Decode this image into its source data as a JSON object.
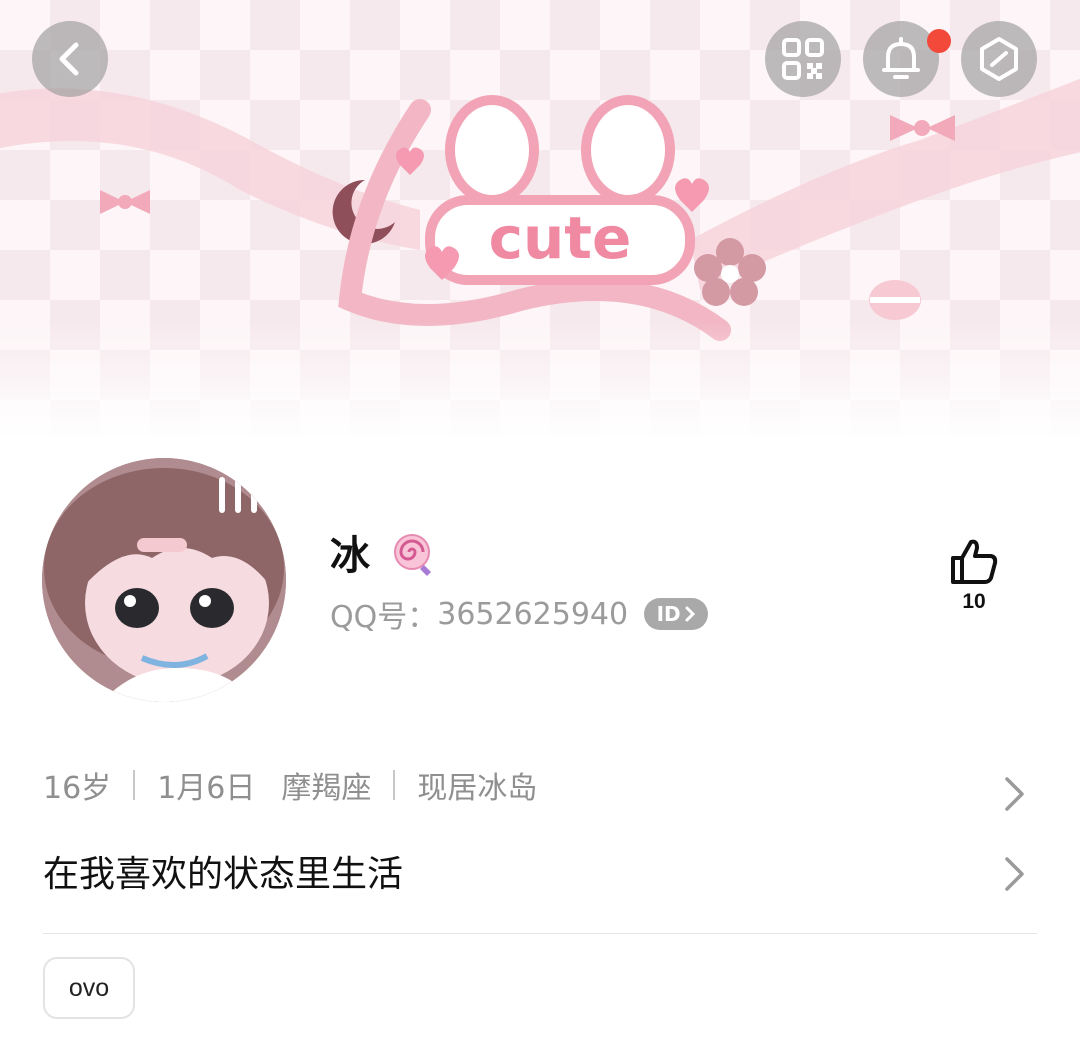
{
  "banner": {
    "logo_text": "cute"
  },
  "topbar": {
    "back_icon": "chevron-left-icon",
    "qr_icon": "qr-code-icon",
    "notification_icon": "bell-icon",
    "settings_icon": "hexagon-icon",
    "notification_dot_color": "#f2493b"
  },
  "profile": {
    "name": "冰",
    "name_icon": "lollipop-icon",
    "qq_label": "QQ号：",
    "qq_number": "3652625940",
    "id_badge": "ID",
    "likes": "10",
    "like_icon": "thumbs-up-icon"
  },
  "info": {
    "age": "16岁",
    "birthday": "1月6日",
    "zodiac": "摩羯座",
    "location": "现居冰岛"
  },
  "signature": "在我喜欢的状态里生活",
  "tags": [
    "ovo"
  ]
}
